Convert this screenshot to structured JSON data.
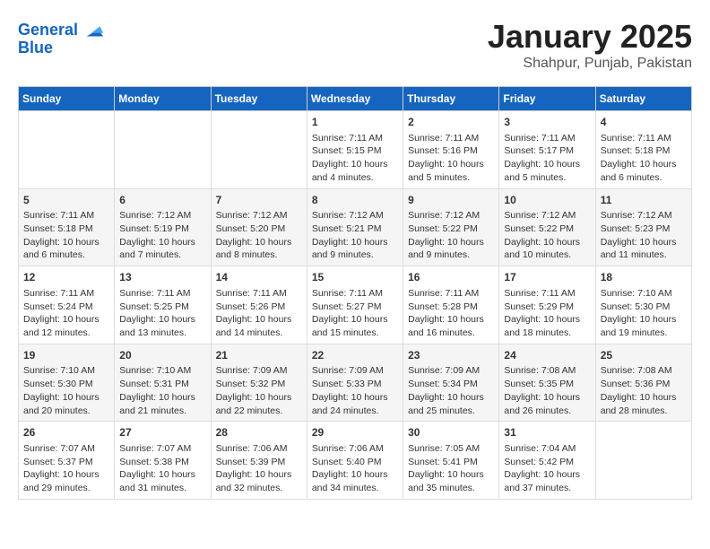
{
  "header": {
    "logo_line1": "General",
    "logo_line2": "Blue",
    "month": "January 2025",
    "location": "Shahpur, Punjab, Pakistan"
  },
  "weekdays": [
    "Sunday",
    "Monday",
    "Tuesday",
    "Wednesday",
    "Thursday",
    "Friday",
    "Saturday"
  ],
  "weeks": [
    [
      {
        "day": "",
        "info": ""
      },
      {
        "day": "",
        "info": ""
      },
      {
        "day": "",
        "info": ""
      },
      {
        "day": "1",
        "info": "Sunrise: 7:11 AM\nSunset: 5:15 PM\nDaylight: 10 hours\nand 4 minutes."
      },
      {
        "day": "2",
        "info": "Sunrise: 7:11 AM\nSunset: 5:16 PM\nDaylight: 10 hours\nand 5 minutes."
      },
      {
        "day": "3",
        "info": "Sunrise: 7:11 AM\nSunset: 5:17 PM\nDaylight: 10 hours\nand 5 minutes."
      },
      {
        "day": "4",
        "info": "Sunrise: 7:11 AM\nSunset: 5:18 PM\nDaylight: 10 hours\nand 6 minutes."
      }
    ],
    [
      {
        "day": "5",
        "info": "Sunrise: 7:11 AM\nSunset: 5:18 PM\nDaylight: 10 hours\nand 6 minutes."
      },
      {
        "day": "6",
        "info": "Sunrise: 7:12 AM\nSunset: 5:19 PM\nDaylight: 10 hours\nand 7 minutes."
      },
      {
        "day": "7",
        "info": "Sunrise: 7:12 AM\nSunset: 5:20 PM\nDaylight: 10 hours\nand 8 minutes."
      },
      {
        "day": "8",
        "info": "Sunrise: 7:12 AM\nSunset: 5:21 PM\nDaylight: 10 hours\nand 9 minutes."
      },
      {
        "day": "9",
        "info": "Sunrise: 7:12 AM\nSunset: 5:22 PM\nDaylight: 10 hours\nand 9 minutes."
      },
      {
        "day": "10",
        "info": "Sunrise: 7:12 AM\nSunset: 5:22 PM\nDaylight: 10 hours\nand 10 minutes."
      },
      {
        "day": "11",
        "info": "Sunrise: 7:12 AM\nSunset: 5:23 PM\nDaylight: 10 hours\nand 11 minutes."
      }
    ],
    [
      {
        "day": "12",
        "info": "Sunrise: 7:11 AM\nSunset: 5:24 PM\nDaylight: 10 hours\nand 12 minutes."
      },
      {
        "day": "13",
        "info": "Sunrise: 7:11 AM\nSunset: 5:25 PM\nDaylight: 10 hours\nand 13 minutes."
      },
      {
        "day": "14",
        "info": "Sunrise: 7:11 AM\nSunset: 5:26 PM\nDaylight: 10 hours\nand 14 minutes."
      },
      {
        "day": "15",
        "info": "Sunrise: 7:11 AM\nSunset: 5:27 PM\nDaylight: 10 hours\nand 15 minutes."
      },
      {
        "day": "16",
        "info": "Sunrise: 7:11 AM\nSunset: 5:28 PM\nDaylight: 10 hours\nand 16 minutes."
      },
      {
        "day": "17",
        "info": "Sunrise: 7:11 AM\nSunset: 5:29 PM\nDaylight: 10 hours\nand 18 minutes."
      },
      {
        "day": "18",
        "info": "Sunrise: 7:10 AM\nSunset: 5:30 PM\nDaylight: 10 hours\nand 19 minutes."
      }
    ],
    [
      {
        "day": "19",
        "info": "Sunrise: 7:10 AM\nSunset: 5:30 PM\nDaylight: 10 hours\nand 20 minutes."
      },
      {
        "day": "20",
        "info": "Sunrise: 7:10 AM\nSunset: 5:31 PM\nDaylight: 10 hours\nand 21 minutes."
      },
      {
        "day": "21",
        "info": "Sunrise: 7:09 AM\nSunset: 5:32 PM\nDaylight: 10 hours\nand 22 minutes."
      },
      {
        "day": "22",
        "info": "Sunrise: 7:09 AM\nSunset: 5:33 PM\nDaylight: 10 hours\nand 24 minutes."
      },
      {
        "day": "23",
        "info": "Sunrise: 7:09 AM\nSunset: 5:34 PM\nDaylight: 10 hours\nand 25 minutes."
      },
      {
        "day": "24",
        "info": "Sunrise: 7:08 AM\nSunset: 5:35 PM\nDaylight: 10 hours\nand 26 minutes."
      },
      {
        "day": "25",
        "info": "Sunrise: 7:08 AM\nSunset: 5:36 PM\nDaylight: 10 hours\nand 28 minutes."
      }
    ],
    [
      {
        "day": "26",
        "info": "Sunrise: 7:07 AM\nSunset: 5:37 PM\nDaylight: 10 hours\nand 29 minutes."
      },
      {
        "day": "27",
        "info": "Sunrise: 7:07 AM\nSunset: 5:38 PM\nDaylight: 10 hours\nand 31 minutes."
      },
      {
        "day": "28",
        "info": "Sunrise: 7:06 AM\nSunset: 5:39 PM\nDaylight: 10 hours\nand 32 minutes."
      },
      {
        "day": "29",
        "info": "Sunrise: 7:06 AM\nSunset: 5:40 PM\nDaylight: 10 hours\nand 34 minutes."
      },
      {
        "day": "30",
        "info": "Sunrise: 7:05 AM\nSunset: 5:41 PM\nDaylight: 10 hours\nand 35 minutes."
      },
      {
        "day": "31",
        "info": "Sunrise: 7:04 AM\nSunset: 5:42 PM\nDaylight: 10 hours\nand 37 minutes."
      },
      {
        "day": "",
        "info": ""
      }
    ]
  ]
}
